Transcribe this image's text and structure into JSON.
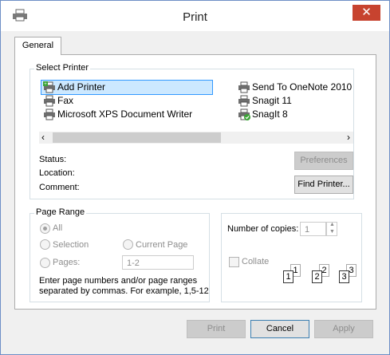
{
  "window": {
    "title": "Print",
    "close_glyph": "✕"
  },
  "tabs": [
    {
      "label": "General"
    }
  ],
  "select_printer": {
    "label": "Select Printer",
    "printers_left": [
      {
        "label": "Add Printer",
        "icon": "add-printer-icon",
        "selected": true
      },
      {
        "label": "Fax",
        "icon": "fax-icon"
      },
      {
        "label": "Microsoft XPS Document Writer",
        "icon": "printer-icon"
      }
    ],
    "printers_right": [
      {
        "label": "Send To OneNote 2010",
        "icon": "printer-icon"
      },
      {
        "label": "Snagit 11",
        "icon": "printer-icon"
      },
      {
        "label": "SnagIt 8",
        "icon": "default-printer-icon"
      }
    ],
    "status_label": "Status:",
    "location_label": "Location:",
    "comment_label": "Comment:",
    "preferences_label": "Preferences",
    "find_printer_label": "Find Printer..."
  },
  "page_range": {
    "label": "Page Range",
    "all_label": "All",
    "selection_label": "Selection",
    "current_page_label": "Current Page",
    "pages_label": "Pages:",
    "pages_value": "1-2",
    "hint": "Enter page numbers and/or page ranges separated by commas.  For example, 1,5-12"
  },
  "copies": {
    "label": "Number of copies:",
    "value": "1",
    "collate_label": "Collate",
    "page_labels": [
      "1",
      "1",
      "2",
      "2",
      "3",
      "3"
    ]
  },
  "footer": {
    "print_label": "Print",
    "cancel_label": "Cancel",
    "apply_label": "Apply"
  }
}
